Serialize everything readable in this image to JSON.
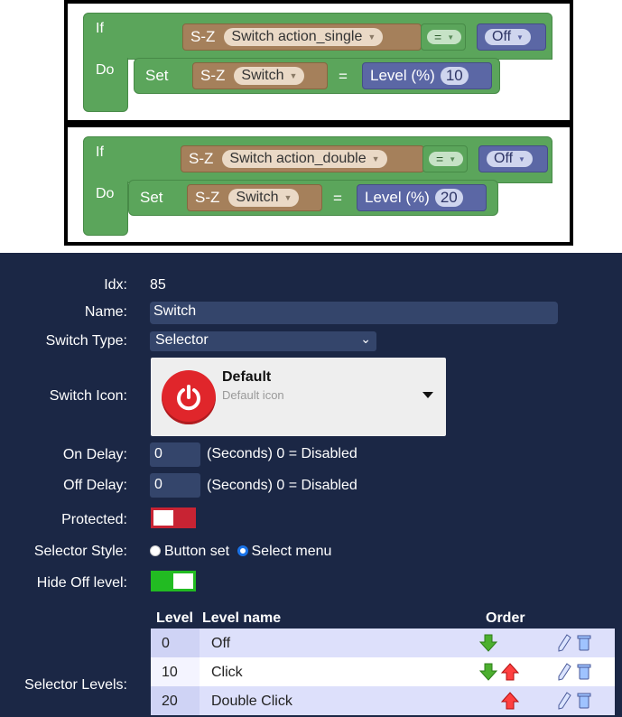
{
  "blocks": [
    {
      "if_label": "If",
      "do_label": "Do",
      "cond_device_type": "S-Z",
      "cond_device": "Switch action_single",
      "cond_operator": "=",
      "cond_value": "Off",
      "set_label": "Set",
      "set_device_type": "S-Z",
      "set_device": "Switch",
      "set_eq": "=",
      "set_param": "Level (%)",
      "set_value": "10"
    },
    {
      "if_label": "If",
      "do_label": "Do",
      "cond_device_type": "S-Z",
      "cond_device": "Switch action_double",
      "cond_operator": "=",
      "cond_value": "Off",
      "set_label": "Set",
      "set_device_type": "S-Z",
      "set_device": "Switch",
      "set_eq": "=",
      "set_param": "Level (%)",
      "set_value": "20"
    }
  ],
  "form": {
    "idx_label": "Idx:",
    "idx_value": "85",
    "name_label": "Name:",
    "name_value": "Switch",
    "switch_type_label": "Switch Type:",
    "switch_type_value": "Selector",
    "switch_icon_label": "Switch Icon:",
    "icon_title": "Default",
    "icon_subtitle": "Default icon",
    "on_delay_label": "On Delay:",
    "on_delay_value": "0",
    "on_delay_hint": "(Seconds) 0 = Disabled",
    "off_delay_label": "Off Delay:",
    "off_delay_value": "0",
    "off_delay_hint": "(Seconds) 0 = Disabled",
    "protected_label": "Protected:",
    "selector_style_label": "Selector Style:",
    "style_option_1": "Button set",
    "style_option_2": "Select menu",
    "hide_off_label": "Hide Off level:",
    "selector_levels_label": "Selector Levels:"
  },
  "table": {
    "headers": {
      "level": "Level",
      "name": "Level name",
      "order": "Order"
    },
    "rows": [
      {
        "level": "0",
        "name": "Off"
      },
      {
        "level": "10",
        "name": "Click"
      },
      {
        "level": "20",
        "name": "Double Click"
      }
    ]
  },
  "colors": {
    "form_bg": "#1b2745",
    "block_green": "#5ba55b",
    "block_brown": "#a5805b",
    "block_blue": "#5b67a5",
    "toggle_red": "#c82333",
    "toggle_green": "#22bb22"
  }
}
